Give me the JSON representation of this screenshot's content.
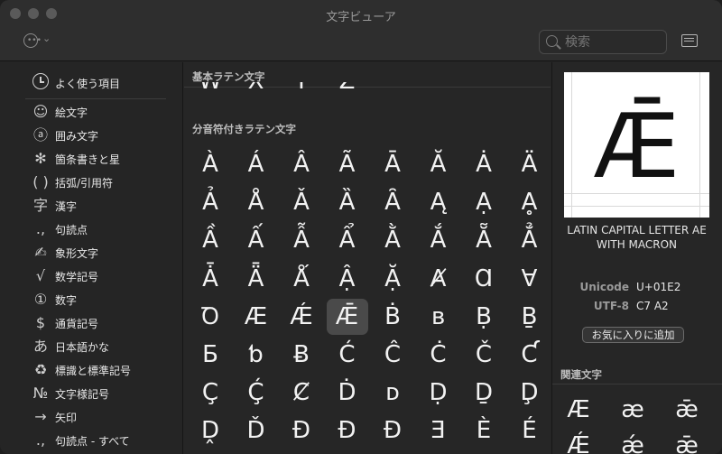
{
  "window": {
    "title": "文字ビューア"
  },
  "toolbar": {
    "search_placeholder": "検索"
  },
  "sidebar": {
    "items": [
      {
        "icon": "clock-icon",
        "glyph": "",
        "label": "よく使う項目"
      },
      {
        "icon": "smiley-icon",
        "glyph": "☺",
        "label": "絵文字"
      },
      {
        "icon": "circled-a-icon",
        "glyph": "ⓐ",
        "label": "囲み文字"
      },
      {
        "icon": "asterisk-icon",
        "glyph": "✻",
        "label": "箇条書きと星"
      },
      {
        "icon": "parentheses-icon",
        "glyph": "( )",
        "label": "括弧/引用符"
      },
      {
        "icon": "kanji-icon",
        "glyph": "字",
        "label": "漢字"
      },
      {
        "icon": "punctuation-icon",
        "glyph": ".,",
        "label": "句読点"
      },
      {
        "icon": "signature-icon",
        "glyph": "✍",
        "label": "象形文字"
      },
      {
        "icon": "square-root-icon",
        "glyph": "√",
        "label": "数学記号"
      },
      {
        "icon": "circled-one-icon",
        "glyph": "①",
        "label": "数字"
      },
      {
        "icon": "dollar-icon",
        "glyph": "$",
        "label": "通貨記号"
      },
      {
        "icon": "hiragana-icon",
        "glyph": "あ",
        "label": "日本語かな"
      },
      {
        "icon": "recycle-icon",
        "glyph": "♻",
        "label": "標識と標準記号"
      },
      {
        "icon": "numero-icon",
        "glyph": "№",
        "label": "文字様記号"
      },
      {
        "icon": "arrow-icon",
        "glyph": "→",
        "label": "矢印"
      },
      {
        "icon": "punctuation-icon",
        "glyph": ".,",
        "label": "句読点 - すべて"
      }
    ]
  },
  "main": {
    "section_prev": {
      "title": "基本ラテン文字",
      "chars": [
        "W",
        "X",
        "Y",
        "Z"
      ]
    },
    "section": {
      "title": "分音符付きラテン文字",
      "rows": [
        [
          "À",
          "Á",
          "Â",
          "Ã",
          "Ā",
          "Ă",
          "Ȧ",
          "Ä"
        ],
        [
          "Ả",
          "Å",
          "Ǎ",
          "Ȁ",
          "Ȃ",
          "Ą",
          "Ạ",
          "Ḁ"
        ],
        [
          "Ầ",
          "Ấ",
          "Ẫ",
          "Ẩ",
          "Ằ",
          "Ắ",
          "Ẵ",
          "Ẳ"
        ],
        [
          "Ǡ",
          "Ǟ",
          "Ǻ",
          "Ậ",
          "Ặ",
          "Ⱥ",
          "Ɑ",
          "Ɐ"
        ],
        [
          "Ꝺ",
          "Æ",
          "Ǽ",
          "Ǣ",
          "Ḃ",
          "ʙ",
          "Ḅ",
          "Ḇ"
        ],
        [
          "Ƃ",
          "ƅ",
          "Ƀ",
          "Ć",
          "Ĉ",
          "Ċ",
          "Č",
          "Ƈ"
        ],
        [
          "Ç",
          "Ḉ",
          "Ȼ",
          "Ḋ",
          "ᴅ",
          "Ḍ",
          "Ḏ",
          "Ḑ"
        ],
        [
          "Ḓ",
          "Ď",
          "Đ",
          "Ð",
          "Ɖ",
          "Ǝ",
          "È",
          "É"
        ]
      ],
      "selected": "Ǣ"
    }
  },
  "inspector": {
    "glyph": "Ǣ",
    "name": "LATIN CAPITAL LETTER AE WITH MACRON",
    "unicode_label": "Unicode",
    "unicode_value": "U+01E2",
    "utf8_label": "UTF-8",
    "utf8_value": "C7 A2",
    "favorite_button": "お気に入りに追加",
    "related_title": "関連文字",
    "related": [
      "Æ",
      "æ",
      "ǣ",
      "Ǽ",
      "ǽ",
      "ǣ"
    ]
  },
  "colors": {
    "window_bg": "#262626",
    "selection": "#4a4a4a",
    "preview_bg": "#ffffff"
  }
}
